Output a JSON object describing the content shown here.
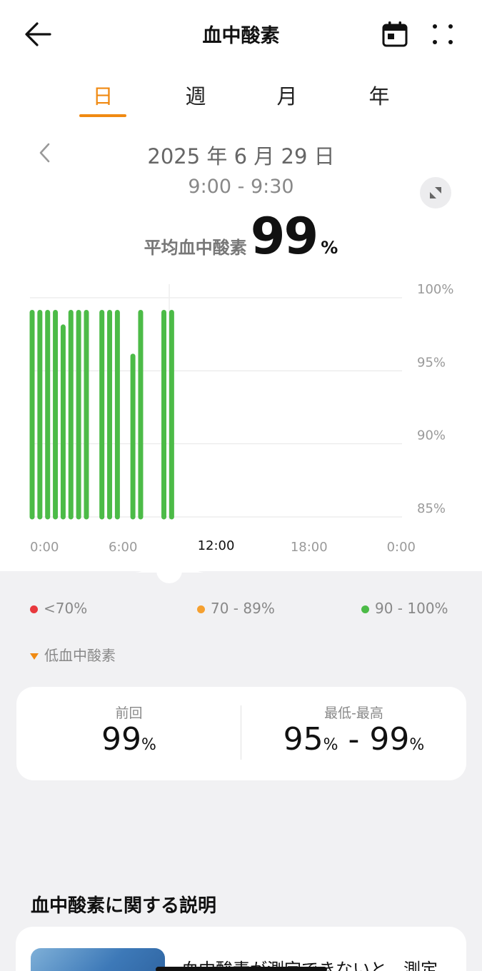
{
  "header": {
    "title": "血中酸素",
    "back_icon": "arrow-left-icon",
    "calendar_icon": "calendar-icon",
    "more_icon": "more-dots-icon"
  },
  "tabs": [
    {
      "label": "日",
      "active": true
    },
    {
      "label": "週",
      "active": false
    },
    {
      "label": "月",
      "active": false
    },
    {
      "label": "年",
      "active": false
    }
  ],
  "period": {
    "date": "2025 年 6 月 29 日",
    "time_range": "9:00 - 9:30"
  },
  "average": {
    "label": "平均血中酸素",
    "value": "99",
    "unit": "%"
  },
  "colors": {
    "accent": "#f08a12",
    "bar_green": "#4cbb47",
    "red": "#e8383d",
    "orange": "#f5a030",
    "green": "#4cbb47"
  },
  "chart_data": {
    "type": "bar",
    "x_ticks": [
      "0:00",
      "6:00",
      "12:00",
      "18:00",
      "0:00"
    ],
    "y_ticks": [
      "100%",
      "95%",
      "90%",
      "85%"
    ],
    "ylim": [
      85,
      100
    ],
    "xlim_hours": [
      0,
      24
    ],
    "grid": true,
    "series": [
      {
        "x_hours": [
          0.0,
          0.5,
          1.0,
          1.5,
          2.0,
          2.5,
          3.0,
          3.5,
          4.5,
          5.0,
          5.5,
          6.5,
          7.0,
          8.5,
          9.0
        ],
        "values": [
          99,
          99,
          99,
          99,
          98,
          99,
          99,
          99,
          99,
          99,
          99,
          96,
          99,
          99,
          99
        ]
      }
    ]
  },
  "legend": [
    {
      "label": "<70%",
      "color": "#e8383d"
    },
    {
      "label": "70 - 89%",
      "color": "#f5a030"
    },
    {
      "label": "90 - 100%",
      "color": "#4cbb47"
    }
  ],
  "low_oxygen_label": "低血中酸素",
  "stats": {
    "previous_label": "前回",
    "previous_value": "99",
    "unit": "%",
    "range_label": "最低-最高",
    "min_value": "95",
    "max_value": "99",
    "separator": " - "
  },
  "info": {
    "section_title": "血中酸素に関する説明",
    "item_text": "血中酸素が測定できないと、測定"
  }
}
